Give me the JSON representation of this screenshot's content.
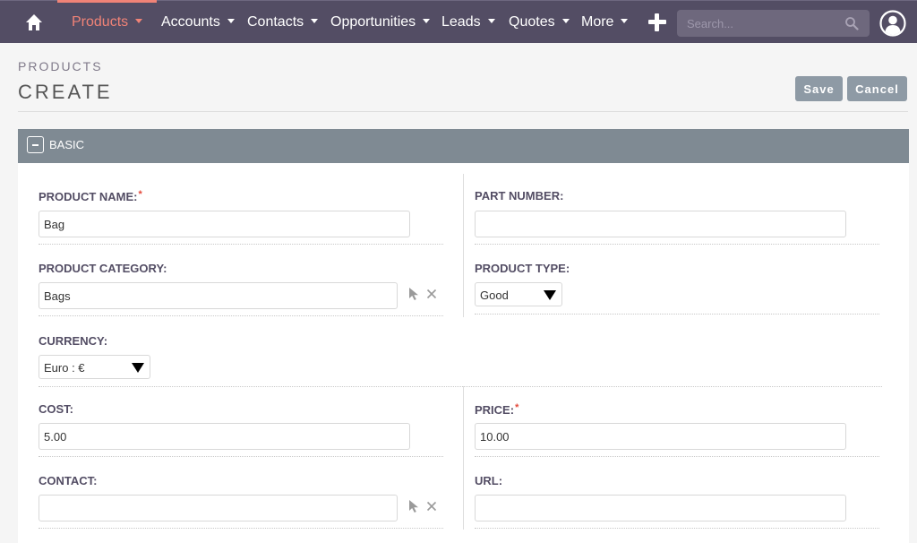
{
  "nav": {
    "items": [
      {
        "label": "Products",
        "active": true
      },
      {
        "label": "Accounts"
      },
      {
        "label": "Contacts"
      },
      {
        "label": "Opportunities"
      },
      {
        "label": "Leads"
      },
      {
        "label": "Quotes"
      },
      {
        "label": "More"
      }
    ],
    "search_placeholder": "Search...",
    "icons": {
      "home": "home-icon",
      "create": "plus-icon",
      "search": "search-icon",
      "user": "user-profile-icon"
    },
    "colors": {
      "bar": "#534d64",
      "active": "#f08377"
    }
  },
  "header": {
    "module": "PRODUCTS",
    "title": "CREATE",
    "save_label": "Save",
    "cancel_label": "Cancel"
  },
  "panel": {
    "title": "BASIC",
    "collapse_symbol": "−",
    "fields": {
      "product_name": {
        "label": "PRODUCT NAME:",
        "required": "*",
        "value": "Bag"
      },
      "part_number": {
        "label": "PART NUMBER:",
        "value": ""
      },
      "product_category": {
        "label": "PRODUCT CATEGORY:",
        "value": "Bags"
      },
      "product_type": {
        "label": "PRODUCT TYPE:",
        "value": "Good"
      },
      "currency": {
        "label": "CURRENCY:",
        "value": "Euro : €"
      },
      "cost": {
        "label": "COST:",
        "value": "5.00"
      },
      "price": {
        "label": "PRICE:",
        "required": "*",
        "value": "10.00"
      },
      "contact": {
        "label": "CONTACT:",
        "value": ""
      },
      "url": {
        "label": "URL:",
        "value": ""
      }
    }
  }
}
